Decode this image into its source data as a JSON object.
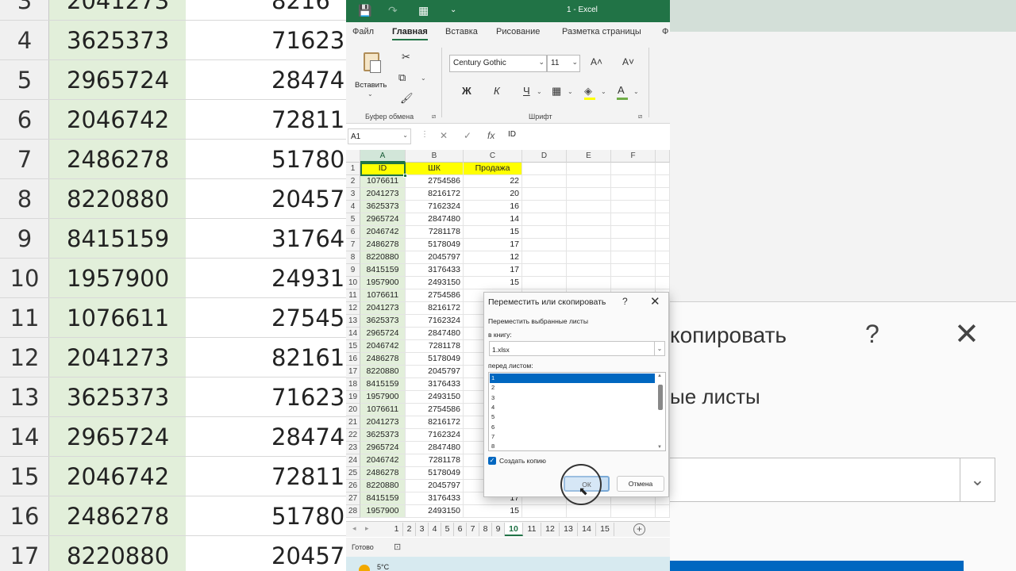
{
  "background": {
    "rows": [
      {
        "n": "3",
        "a": "2041273",
        "b": "8216"
      },
      {
        "n": "4",
        "a": "3625373",
        "b": "71623"
      },
      {
        "n": "5",
        "a": "2965724",
        "b": "28474"
      },
      {
        "n": "6",
        "a": "2046742",
        "b": "72811"
      },
      {
        "n": "7",
        "a": "2486278",
        "b": "51780"
      },
      {
        "n": "8",
        "a": "8220880",
        "b": "20457"
      },
      {
        "n": "9",
        "a": "8415159",
        "b": "31764"
      },
      {
        "n": "10",
        "a": "1957900",
        "b": "24931"
      },
      {
        "n": "11",
        "a": "1076611",
        "b": "27545"
      },
      {
        "n": "12",
        "a": "2041273",
        "b": "82161"
      },
      {
        "n": "13",
        "a": "3625373",
        "b": "71623"
      },
      {
        "n": "14",
        "a": "2965724",
        "b": "28474"
      },
      {
        "n": "15",
        "a": "2046742",
        "b": "72811"
      },
      {
        "n": "16",
        "a": "2486278",
        "b": "51780"
      },
      {
        "n": "17",
        "a": "8220880",
        "b": "20457"
      }
    ],
    "dialog_title_fragment": "копировать",
    "dialog_q": "?",
    "dialog_x": "✕",
    "dialog_sub_fragment": "ые листы",
    "combo_arrow": "⌄"
  },
  "titlebar": {
    "title": "1  -  Excel",
    "save_icon": "💾",
    "redo_icon": "↷",
    "form_icon": "▦",
    "more_icon": "⌄"
  },
  "menu": {
    "tabs": [
      "Файл",
      "Главная",
      "Вставка",
      "Рисование",
      "Разметка страницы",
      "Ф"
    ],
    "active_index": 1
  },
  "ribbon": {
    "paste_label": "Вставить",
    "paste_arrow": "⌄",
    "clipboard_label": "Буфер обмена",
    "font_label": "Шрифт",
    "font_name": "Century Gothic",
    "font_size": "11",
    "bold": "Ж",
    "italic": "К",
    "underline": "Ч",
    "grow_font": "A˄",
    "shrink_font": "A˅",
    "cut_icon": "✂",
    "copy_icon": "⧉",
    "brush_icon": "🖌",
    "border_icon": "▦",
    "fill_icon": "◈",
    "color_icon": "A",
    "dropdown": "⌄",
    "launcher": "⧄"
  },
  "formula_bar": {
    "name_box": "A1",
    "cancel": "✕",
    "enter": "✓",
    "fx": "fx",
    "value": "ID",
    "sep": "⋮"
  },
  "sheet": {
    "columns": [
      "A",
      "B",
      "C",
      "D",
      "E",
      "F"
    ],
    "header": [
      "ID",
      "ШК",
      "Продажа"
    ],
    "rows": [
      [
        "1076611",
        "2754586",
        "22"
      ],
      [
        "2041273",
        "8216172",
        "20"
      ],
      [
        "3625373",
        "7162324",
        "16"
      ],
      [
        "2965724",
        "2847480",
        "14"
      ],
      [
        "2046742",
        "7281178",
        "15"
      ],
      [
        "2486278",
        "5178049",
        "17"
      ],
      [
        "8220880",
        "2045797",
        "12"
      ],
      [
        "8415159",
        "3176433",
        "17"
      ],
      [
        "1957900",
        "2493150",
        "15"
      ],
      [
        "1076611",
        "2754586",
        ""
      ],
      [
        "2041273",
        "8216172",
        ""
      ],
      [
        "3625373",
        "7162324",
        ""
      ],
      [
        "2965724",
        "2847480",
        ""
      ],
      [
        "2046742",
        "7281178",
        ""
      ],
      [
        "2486278",
        "5178049",
        ""
      ],
      [
        "8220880",
        "2045797",
        ""
      ],
      [
        "8415159",
        "3176433",
        ""
      ],
      [
        "1957900",
        "2493150",
        ""
      ],
      [
        "1076611",
        "2754586",
        ""
      ],
      [
        "2041273",
        "8216172",
        ""
      ],
      [
        "3625373",
        "7162324",
        ""
      ],
      [
        "2965724",
        "2847480",
        ""
      ],
      [
        "2046742",
        "7281178",
        ""
      ],
      [
        "2486278",
        "5178049",
        ""
      ],
      [
        "8220880",
        "2045797",
        ""
      ],
      [
        "8415159",
        "3176433",
        "17"
      ],
      [
        "1957900",
        "2493150",
        "15"
      ]
    ]
  },
  "sheet_tabs": {
    "nav_prev": "◂",
    "nav_next": "▸",
    "tabs": [
      "1",
      "2",
      "3",
      "4",
      "5",
      "6",
      "7",
      "8",
      "9",
      "10",
      "11",
      "12",
      "13",
      "14",
      "15"
    ],
    "active": "10",
    "add": "+"
  },
  "status": {
    "ready": "Готово",
    "accessibility_icon": "⊡"
  },
  "taskbar": {
    "temp": "5°C"
  },
  "dialog": {
    "title": "Переместить или скопировать",
    "help": "?",
    "close": "✕",
    "move_label": "Переместить выбранные листы",
    "book_label": "в книгу:",
    "book_value": "1.xlsx",
    "book_arrow": "⌄",
    "before_label": "перед листом:",
    "sheets": [
      "1",
      "2",
      "3",
      "4",
      "5",
      "6",
      "7",
      "8"
    ],
    "selected_index": 0,
    "scroll_up": "▲",
    "scroll_down": "▼",
    "copy_label": "Создать копию",
    "copy_checked": true,
    "check_mark": "✓",
    "ok": "ОК",
    "cancel": "Отмена"
  },
  "cursor_icon": "⬉"
}
